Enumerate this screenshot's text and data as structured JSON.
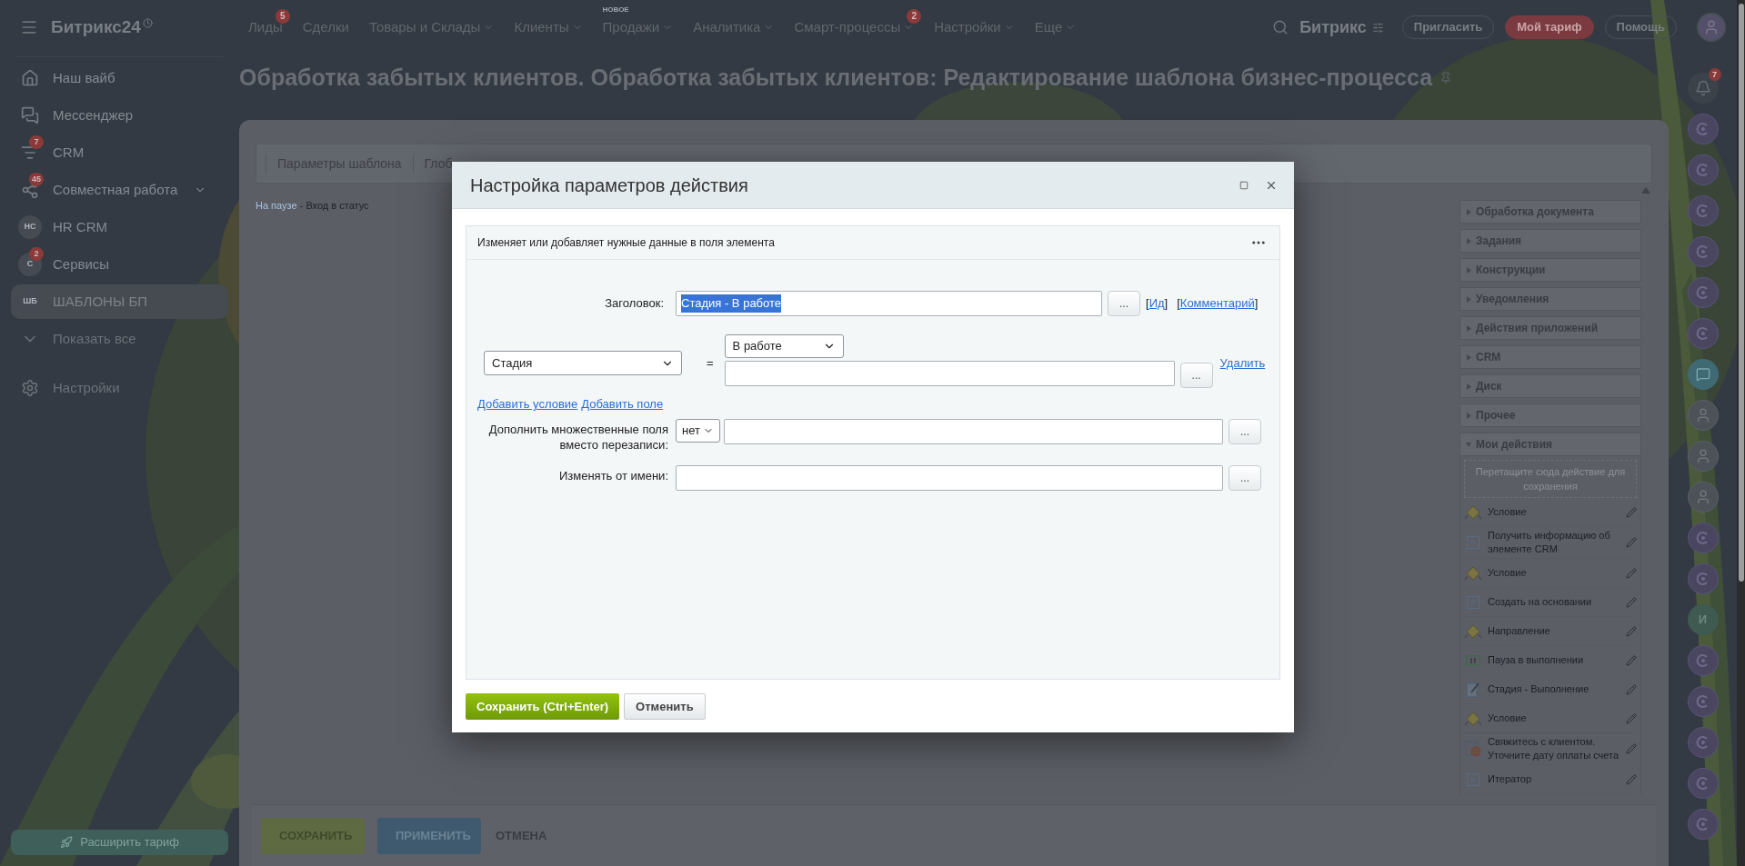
{
  "topbar": {
    "logo": "Битрикс24",
    "nav": [
      {
        "label": "Лиды",
        "dropdown": false,
        "badge": "5"
      },
      {
        "label": "Сделки",
        "dropdown": false
      },
      {
        "label": "Товары и Склады",
        "dropdown": true
      },
      {
        "label": "Клиенты",
        "dropdown": true
      },
      {
        "label": "Продажи",
        "dropdown": true,
        "tag": "НОВОЕ"
      },
      {
        "label": "Аналитика",
        "dropdown": true
      },
      {
        "label": "Смарт-процессы",
        "dropdown": true,
        "badge": "2"
      },
      {
        "label": "Настройки",
        "dropdown": true
      },
      {
        "label": "Еще",
        "dropdown": true
      }
    ],
    "company": "Битрикс",
    "buttons": [
      {
        "label": "Пригласить",
        "kind": "outline"
      },
      {
        "label": "Мой тариф",
        "kind": "accent"
      },
      {
        "label": "Помощь",
        "kind": "outline"
      }
    ]
  },
  "sidebar": {
    "items": [
      {
        "label": "Наш вайб",
        "kind": "icon",
        "selected": false
      },
      {
        "label": "Мессенджер",
        "kind": "icon",
        "selected": false
      },
      {
        "label": "CRM",
        "kind": "icon",
        "badge": "7",
        "selected": false
      },
      {
        "label": "Совместная работа",
        "kind": "icon",
        "badge": "45",
        "expandable": true,
        "selected": false
      },
      {
        "label": "HR CRM",
        "kind": "avatar",
        "avatar": "HC",
        "selected": false
      },
      {
        "label": "Сервисы",
        "kind": "avatar",
        "avatar": "C",
        "badge": "2",
        "selected": false
      },
      {
        "label": "ШАБЛОНЫ БП",
        "kind": "avatar",
        "avatar": "ШБ",
        "selected": true
      }
    ],
    "show_all": "Показать все",
    "settings": "Настройки",
    "upgrade_button": "Расширить тариф"
  },
  "page": {
    "title": "Обработка забытых клиентов. Обработка забытых клиентов: Редактирование шаблона бизнес-процесса",
    "tabs": [
      "Параметры шаблона",
      "Глоб"
    ],
    "breadcrumb": {
      "link": "На паузе",
      "text": "- Вход в статус"
    },
    "palette": {
      "groups": [
        {
          "label": "Обработка документа",
          "expanded": false
        },
        {
          "label": "Задания",
          "expanded": false
        },
        {
          "label": "Конструкции",
          "expanded": false
        },
        {
          "label": "Уведомления",
          "expanded": false
        },
        {
          "label": "Действия приложений",
          "expanded": false
        },
        {
          "label": "CRM",
          "expanded": false
        },
        {
          "label": "Диск",
          "expanded": false
        },
        {
          "label": "Прочее",
          "expanded": false
        },
        {
          "label": "Мои действия",
          "expanded": true
        }
      ],
      "drop_hint": "Перетащите сюда действие для сохранения",
      "my_actions": [
        {
          "label": "Условие",
          "kind": "condition"
        },
        {
          "label": "Получить информацию об элементе CRM",
          "kind": "activity"
        },
        {
          "label": "Условие",
          "kind": "condition"
        },
        {
          "label": "Создать на основании",
          "kind": "activity"
        },
        {
          "label": "Направление",
          "kind": "condition"
        },
        {
          "label": "Пауза в выполнении",
          "kind": "pause"
        },
        {
          "label": "Стадия - Выполнение",
          "kind": "stage"
        },
        {
          "label": "Условие",
          "kind": "condition"
        },
        {
          "label": "Свяжитесь с клиентом. Уточните дату оплаты счета",
          "kind": "task"
        },
        {
          "label": "Итератор",
          "kind": "activity"
        }
      ]
    },
    "bottom_buttons": [
      {
        "label": "СОХРАНИТЬ",
        "kind": "save"
      },
      {
        "label": "ПРИМЕНИТЬ",
        "kind": "apply"
      },
      {
        "label": "ОТМЕНА",
        "kind": "cancel"
      }
    ]
  },
  "right_rail": [
    {
      "kind": "bell",
      "badge": "7"
    },
    {
      "kind": "channel"
    },
    {
      "kind": "channel"
    },
    {
      "kind": "channel"
    },
    {
      "kind": "channel"
    },
    {
      "kind": "channel"
    },
    {
      "kind": "channel"
    },
    {
      "kind": "chat"
    },
    {
      "kind": "avatar"
    },
    {
      "kind": "avatar"
    },
    {
      "kind": "avatar"
    },
    {
      "kind": "channel"
    },
    {
      "kind": "channel"
    },
    {
      "kind": "letter",
      "text": "И"
    },
    {
      "kind": "channel"
    },
    {
      "kind": "channel"
    },
    {
      "kind": "channel"
    },
    {
      "kind": "channel"
    },
    {
      "kind": "channel"
    }
  ],
  "dialog": {
    "title": "Настройка параметров действия",
    "description": "Изменяет или добавляет нужные данные в поля элемента",
    "title_row": {
      "label": "Заголовок:",
      "value": "Стадия - В работе",
      "highlighted": true,
      "picker": "...",
      "links": [
        {
          "open": "[",
          "label": "Ид",
          "close": "]"
        },
        {
          "open": "[",
          "label": "Комментарий",
          "close": "]"
        }
      ]
    },
    "condition": {
      "field": "Стадия",
      "operator": "=",
      "value_select": "В работе",
      "picker": "...",
      "delete": "Удалить"
    },
    "add_links": [
      "Добавить условие",
      "Добавить поле"
    ],
    "rows": [
      {
        "label": "Дополнить множественные поля вместо перезаписи:",
        "kind": "select-text",
        "select": "нет",
        "picker": "..."
      },
      {
        "label": "Изменять от имени:",
        "kind": "text",
        "picker": "..."
      }
    ],
    "buttons": [
      {
        "label": "Сохранить (Ctrl+Enter)",
        "kind": "primary"
      },
      {
        "label": "Отменить",
        "kind": "secondary"
      }
    ]
  }
}
